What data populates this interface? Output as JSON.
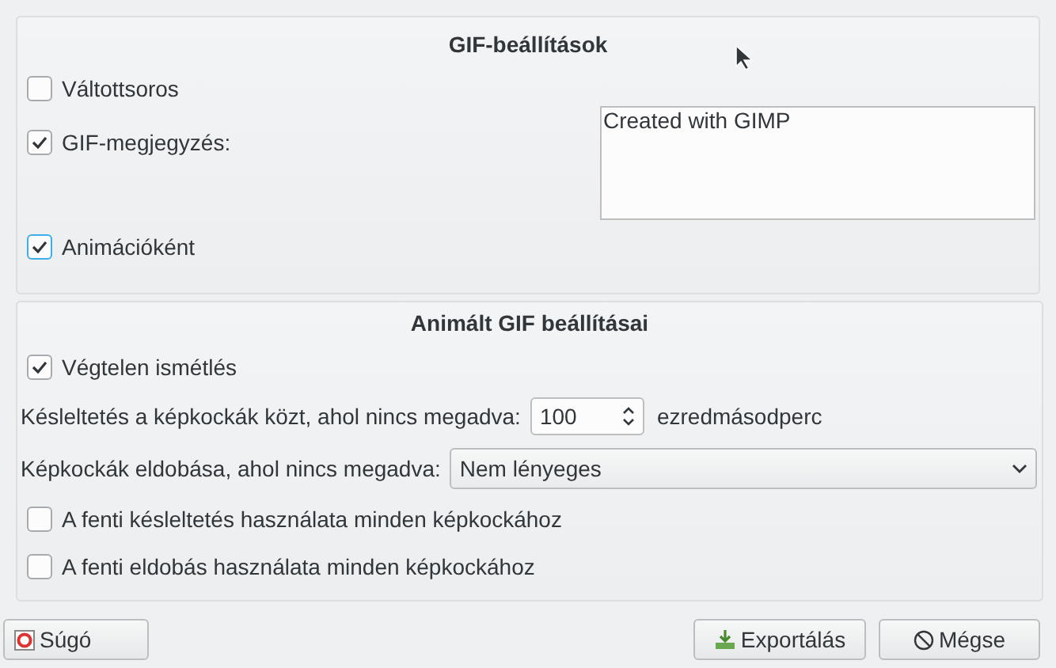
{
  "gif_settings": {
    "title": "GIF-beállítások",
    "interlace": {
      "label": "Váltottsoros",
      "checked": false
    },
    "comment": {
      "label": "GIF-megjegyzés:",
      "checked": true,
      "value": "Created with GIMP"
    },
    "as_animation": {
      "label": "Animációként",
      "checked": true,
      "focused": true
    }
  },
  "animation_settings": {
    "title": "Animált GIF beállításai",
    "loop": {
      "label": "Végtelen ismétlés",
      "checked": true
    },
    "delay": {
      "label": "Késleltetés a képkockák közt, ahol nincs megadva:",
      "value": "100",
      "unit": "ezredmásodperc"
    },
    "disposal": {
      "label": "Képkockák eldobása, ahol nincs megadva:",
      "value": "Nem lényeges"
    },
    "use_delay": {
      "label": "A fenti késleltetés használata minden képkockához",
      "checked": false
    },
    "use_disposal": {
      "label": "A fenti eldobás használata minden képkockához",
      "checked": false
    }
  },
  "buttons": [
    {
      "kind": "help",
      "label": "Súgó"
    },
    {
      "kind": "export",
      "label": "Exportálás"
    },
    {
      "kind": "cancel",
      "label": "Mégse"
    }
  ]
}
